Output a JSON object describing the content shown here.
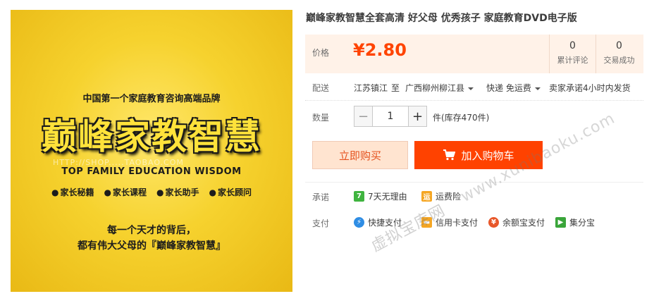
{
  "product_image": {
    "tagline": "中国第一个家庭教育咨询高端品牌",
    "brand": "巅峰家教智慧",
    "english": "TOP FAMILY EDUCATION WISDOM",
    "watermark": "HTTP://SHOP.....TAOBAO.COM",
    "bullets": [
      "家长秘籍",
      "家长课程",
      "家长助手",
      "家长顾问"
    ],
    "slogan_line1": "每一个天才的背后，",
    "slogan_line2": "都有伟大父母的『巅峰家教智慧』"
  },
  "title": "巅峰家教智慧全套高清 好父母 优秀孩子 家庭教育DVD电子版",
  "price": {
    "label": "价格",
    "value": "¥2.80"
  },
  "stats": [
    {
      "count": "0",
      "label": "累计评论"
    },
    {
      "count": "0",
      "label": "交易成功"
    }
  ],
  "shipping": {
    "label": "配送",
    "from": "江苏镇江",
    "to_word": "至",
    "destination": "广西柳州柳江县",
    "method": "快递 免运费",
    "promise": "卖家承诺4小时内发货"
  },
  "quantity": {
    "label": "数量",
    "minus": "−",
    "value": "1",
    "plus": "+",
    "stock": "件(库存470件)"
  },
  "buttons": {
    "buy_now": "立即购买",
    "add_to_cart": "加入购物车"
  },
  "promise": {
    "label": "承诺",
    "items": [
      {
        "icon": "seven-day-return-icon",
        "icon_text": "7",
        "text": "7天无理由",
        "color": "#3fb43f"
      },
      {
        "icon": "shipping-insurance-icon",
        "icon_text": "运",
        "text": "运费险",
        "color": "#f5a623"
      }
    ]
  },
  "payment": {
    "label": "支付",
    "items": [
      {
        "icon": "quick-pay-icon",
        "icon_text": "⚡",
        "text": "快捷支付",
        "color": "#2f8de4"
      },
      {
        "icon": "credit-card-icon",
        "icon_text": "▬",
        "text": "信用卡支付",
        "color": "#f5a623"
      },
      {
        "icon": "yuebao-icon",
        "icon_text": "¥",
        "text": "余额宝支付",
        "color": "#e8572a"
      },
      {
        "icon": "jifenbao-icon",
        "icon_text": "▶",
        "text": "集分宝",
        "color": "#3aa53a"
      }
    ]
  },
  "watermark": {
    "line1": "虚拟宝库网",
    "line2": "www.xunibaoku.com"
  }
}
